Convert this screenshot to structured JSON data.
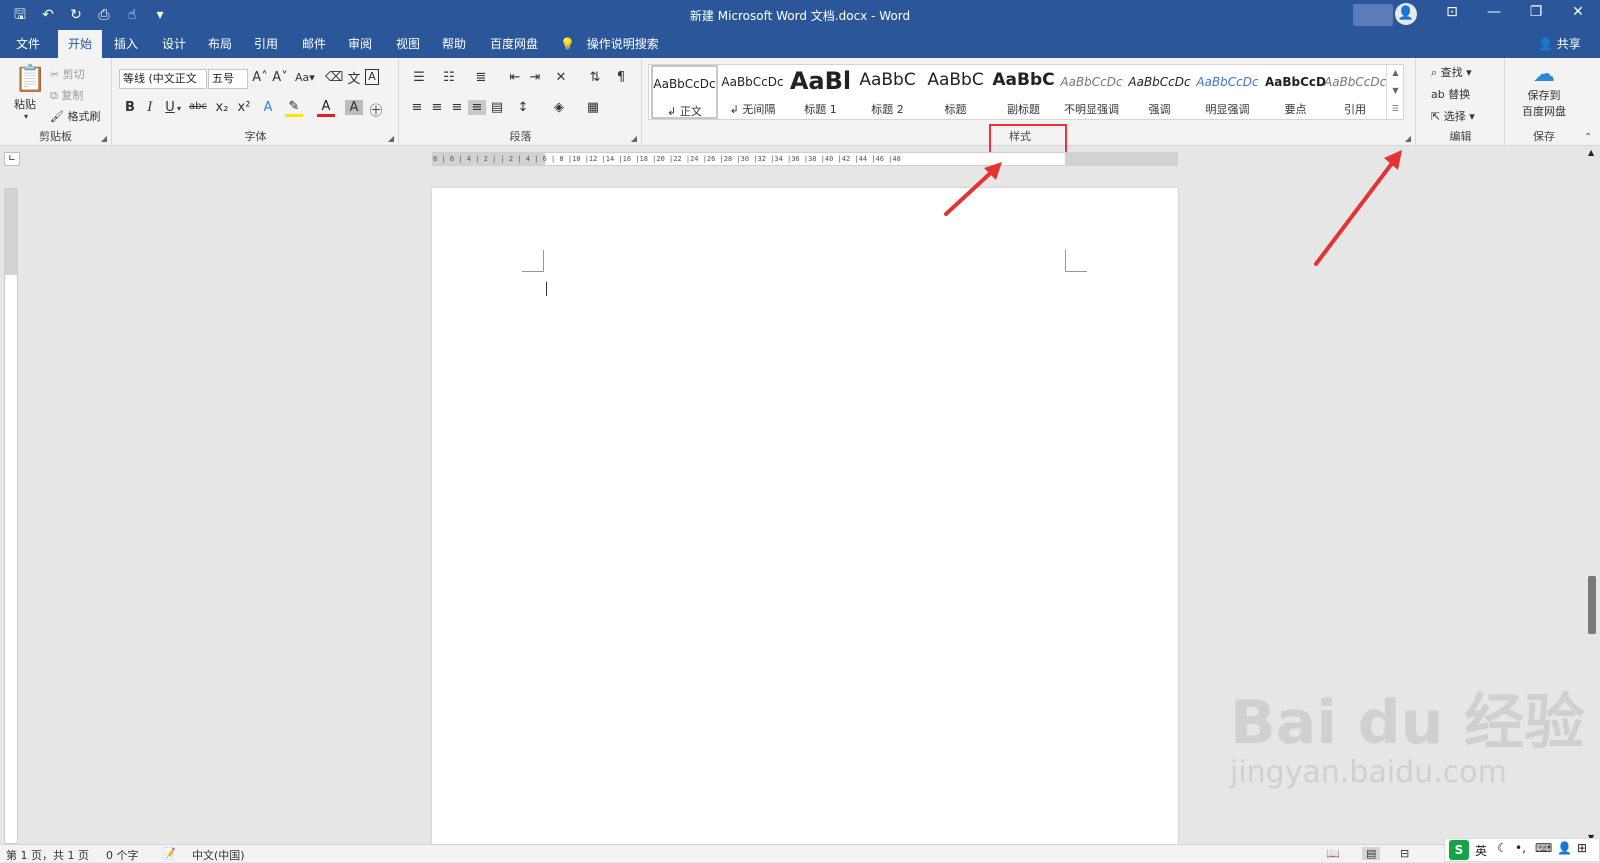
{
  "window": {
    "title": "新建 Microsoft Word 文档.docx - Word",
    "qat_icons": [
      "save-icon",
      "undo-icon",
      "redo-icon",
      "print-preview-icon",
      "touch-mode-icon",
      "customize-qat-icon"
    ],
    "controls": [
      "ribbon-display-icon",
      "minimize-icon",
      "restore-icon",
      "close-icon"
    ]
  },
  "tabs": [
    {
      "label": "文件"
    },
    {
      "label": "开始",
      "active": true
    },
    {
      "label": "插入"
    },
    {
      "label": "设计"
    },
    {
      "label": "布局"
    },
    {
      "label": "引用"
    },
    {
      "label": "邮件"
    },
    {
      "label": "审阅"
    },
    {
      "label": "视图"
    },
    {
      "label": "帮助"
    },
    {
      "label": "百度网盘"
    }
  ],
  "tell_me": "操作说明搜索",
  "share": "共享",
  "ribbon": {
    "clipboard": {
      "label": "剪贴板",
      "paste": "粘贴",
      "cut": "剪切",
      "copy": "复制",
      "format_painter": "格式刷"
    },
    "font": {
      "label": "字体",
      "font_name": "等线 (中文正文",
      "font_size": "五号",
      "case": "Aa",
      "buttons": [
        "B",
        "I",
        "U",
        "abc",
        "x₂",
        "x²",
        "A",
        "A",
        "A"
      ]
    },
    "paragraph": {
      "label": "段落"
    },
    "styles": {
      "label": "样式",
      "items": [
        {
          "preview": "AaBbCcDc",
          "name": "↲ 正文",
          "selected": true
        },
        {
          "preview": "AaBbCcDc",
          "name": "↲ 无间隔"
        },
        {
          "preview": "AaBl",
          "name": "标题 1"
        },
        {
          "preview": "AaBbC",
          "name": "标题 2"
        },
        {
          "preview": "AaBbC",
          "name": "标题"
        },
        {
          "preview": "AaBbC",
          "name": "副标题"
        },
        {
          "preview": "AaBbCcDc",
          "name": "不明显强调"
        },
        {
          "preview": "AaBbCcDc",
          "name": "强调"
        },
        {
          "preview": "AaBbCcDc",
          "name": "明显强调"
        },
        {
          "preview": "AaBbCcD",
          "name": "要点"
        },
        {
          "preview": "AaBbCcDc",
          "name": "引用"
        }
      ]
    },
    "editing": {
      "label": "编辑",
      "find": "查找",
      "replace": "替换",
      "select": "选择"
    },
    "save": {
      "label": "保存",
      "button_line1": "保存到",
      "button_line2": "百度网盘"
    }
  },
  "ruler_numbers": "8 | 6 | 4 | 2 |   | 2 | 4 | 6 | 8 |10 |12 |14 |16 |18 |20 |22 |24 |26 |28 |30 |32 |34 |36 |38 |40 |42 |44 |46 |48",
  "status": {
    "page": "第 1 页，共 1 页",
    "words": "0 个字",
    "language": "中文(中国)"
  },
  "ime": {
    "logo": "S",
    "mode": "英"
  },
  "watermark": {
    "line1": "Bai  du 经验",
    "line2": "jingyan.baidu.com"
  },
  "colors": {
    "brand": "#2b579a",
    "annotation": "#e33333"
  }
}
